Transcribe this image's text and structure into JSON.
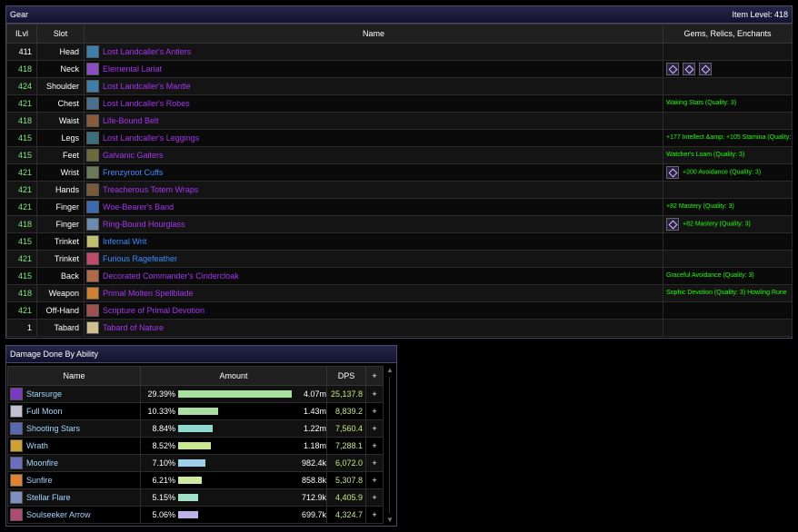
{
  "gear": {
    "title": "Gear",
    "item_level_label": "Item Level: 418",
    "headers": {
      "ilvl": "ILvl",
      "slot": "Slot",
      "name": "Name",
      "gems": "Gems, Relics, Enchants"
    },
    "rows": [
      {
        "ilvl": "411",
        "slot": "Head",
        "name": "Lost Landcaller's Antlers",
        "icon_color": "#3d7fa8",
        "ilvl_white": true,
        "gems": 0,
        "enchant": ""
      },
      {
        "ilvl": "418",
        "slot": "Neck",
        "name": "Elemental Lariat",
        "icon_color": "#8a4ec0",
        "gems": 3,
        "enchant": ""
      },
      {
        "ilvl": "424",
        "slot": "Shoulder",
        "name": "Lost Landcaller's Mantle",
        "icon_color": "#3d7fa8",
        "gems": 0,
        "enchant": ""
      },
      {
        "ilvl": "421",
        "slot": "Chest",
        "name": "Lost Landcaller's Robes",
        "icon_color": "#4a6e8e",
        "gems": 0,
        "enchant": "Waking Stats (Quality: 3)"
      },
      {
        "ilvl": "418",
        "slot": "Waist",
        "name": "Life-Bound Belt",
        "icon_color": "#8a5a3a",
        "gems": 0,
        "enchant": ""
      },
      {
        "ilvl": "415",
        "slot": "Legs",
        "name": "Lost Landcaller's Leggings",
        "icon_color": "#3d6e7e",
        "gems": 0,
        "enchant": "+177 Intellect &amp; +105 Stamina (Quality: 3)"
      },
      {
        "ilvl": "415",
        "slot": "Feet",
        "name": "Galvanic Gaiters",
        "icon_color": "#6a6a3a",
        "gems": 0,
        "enchant": "Watcher's Loam (Quality: 3)"
      },
      {
        "ilvl": "421",
        "slot": "Wrist",
        "name": "Frenzyroot Cuffs",
        "icon_color": "#6a7a5a",
        "blue": true,
        "gems": 1,
        "enchant": "+200 Avoidance (Quality: 3)"
      },
      {
        "ilvl": "421",
        "slot": "Hands",
        "name": "Treacherous Totem Wraps",
        "icon_color": "#7a5a3a",
        "gems": 0,
        "enchant": ""
      },
      {
        "ilvl": "421",
        "slot": "Finger",
        "name": "Woe-Bearer's Band",
        "icon_color": "#3a6ab0",
        "gems": 0,
        "enchant": "+82 Mastery (Quality: 3)"
      },
      {
        "ilvl": "418",
        "slot": "Finger",
        "name": "Ring-Bound Hourglass",
        "icon_color": "#6a8ab0",
        "gems": 1,
        "enchant": "+82 Mastery (Quality: 3)"
      },
      {
        "ilvl": "415",
        "slot": "Trinket",
        "name": "Infernal Writ",
        "icon_color": "#c0c070",
        "blue": true,
        "gems": 0,
        "enchant": ""
      },
      {
        "ilvl": "421",
        "slot": "Trinket",
        "name": "Furious Ragefeather",
        "icon_color": "#c04a6a",
        "blue": true,
        "gems": 0,
        "enchant": ""
      },
      {
        "ilvl": "415",
        "slot": "Back",
        "name": "Decorated Commander's Cindercloak",
        "icon_color": "#b06a4a",
        "gems": 0,
        "enchant": "Graceful Avoidance (Quality: 3)"
      },
      {
        "ilvl": "418",
        "slot": "Weapon",
        "name": "Primal Molten Spellblade",
        "icon_color": "#d08030",
        "gems": 0,
        "enchant": "Sophic Devotion (Quality: 3) Howling Rune"
      },
      {
        "ilvl": "421",
        "slot": "Off-Hand",
        "name": "Scripture of Primal Devotion",
        "icon_color": "#a05050",
        "gems": 0,
        "enchant": ""
      },
      {
        "ilvl": "1",
        "slot": "Tabard",
        "name": "Tabard of Nature",
        "icon_color": "#d0c090",
        "ilvl_white": true,
        "gems": 0,
        "enchant": ""
      }
    ]
  },
  "damage": {
    "title": "Damage Done By Ability",
    "headers": {
      "name": "Name",
      "amount": "Amount",
      "dps": "DPS",
      "plus": "+"
    },
    "rows": [
      {
        "name": "Starsurge",
        "pct": "29.39%",
        "fraction": 1.0,
        "amount": "4.07m",
        "dps": "25,137.8",
        "bar_color": "#a8e0a0",
        "icon_color": "#7a3ac0"
      },
      {
        "name": "Full Moon",
        "pct": "10.33%",
        "fraction": 0.351,
        "amount": "1.43m",
        "dps": "8,839.2",
        "bar_color": "#a8e0a0",
        "icon_color": "#c0c0d0"
      },
      {
        "name": "Shooting Stars",
        "pct": "8.84%",
        "fraction": 0.301,
        "amount": "1.22m",
        "dps": "7,560.4",
        "bar_color": "#90d8d0",
        "icon_color": "#5a6ab0"
      },
      {
        "name": "Wrath",
        "pct": "8.52%",
        "fraction": 0.29,
        "amount": "1.18m",
        "dps": "7,288.1",
        "bar_color": "#c8e890",
        "icon_color": "#d0a030"
      },
      {
        "name": "Moonfire",
        "pct": "7.10%",
        "fraction": 0.242,
        "amount": "982.4k",
        "dps": "6,072.0",
        "bar_color": "#a0d0e8",
        "icon_color": "#6a70c0"
      },
      {
        "name": "Sunfire",
        "pct": "6.21%",
        "fraction": 0.211,
        "amount": "858.8k",
        "dps": "5,307.8",
        "bar_color": "#d0e8a0",
        "icon_color": "#e08030"
      },
      {
        "name": "Stellar Flare",
        "pct": "5.15%",
        "fraction": 0.175,
        "amount": "712.9k",
        "dps": "4,405.9",
        "bar_color": "#a0e0c8",
        "icon_color": "#8090c0"
      },
      {
        "name": "Soulseeker Arrow",
        "pct": "5.06%",
        "fraction": 0.172,
        "amount": "699.7k",
        "dps": "4,324.7",
        "bar_color": "#c0b0e8",
        "icon_color": "#b04a70"
      }
    ]
  }
}
